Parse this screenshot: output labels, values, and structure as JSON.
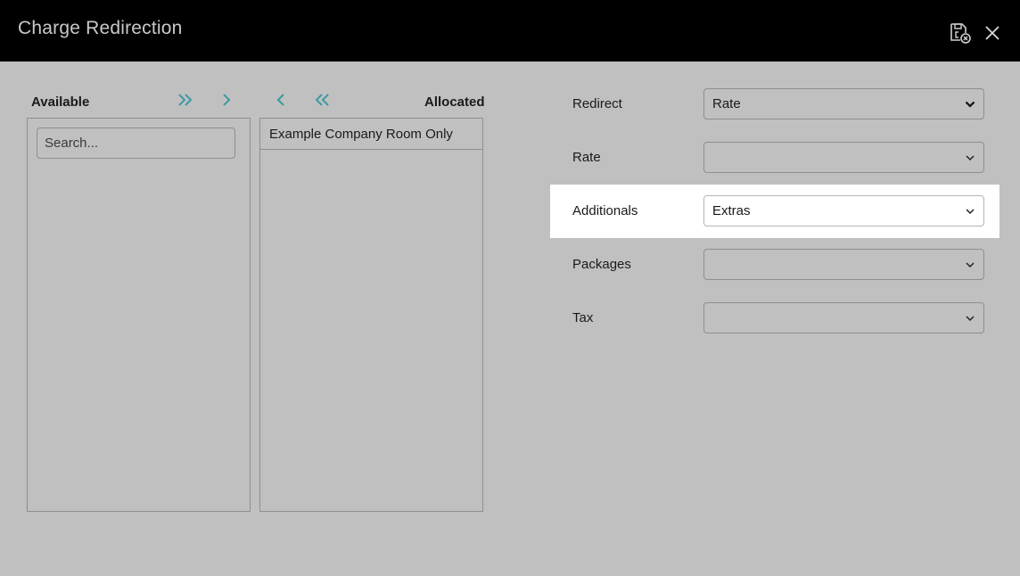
{
  "window": {
    "title": "Charge Redirection",
    "icons": {
      "save": "save-cancel-icon",
      "close": "close-icon"
    }
  },
  "picker": {
    "available_label": "Available",
    "allocated_label": "Allocated",
    "search_placeholder": "Search...",
    "allocated_items": [
      "Example Company Room Only"
    ],
    "accent_color": "#3a9aa3"
  },
  "form": {
    "redirect": {
      "label": "Redirect",
      "value": "Rate"
    },
    "rate": {
      "label": "Rate",
      "value": ""
    },
    "additionals": {
      "label": "Additionals",
      "value": "Extras",
      "highlighted": true
    },
    "packages": {
      "label": "Packages",
      "value": ""
    },
    "tax": {
      "label": "Tax",
      "value": ""
    }
  }
}
